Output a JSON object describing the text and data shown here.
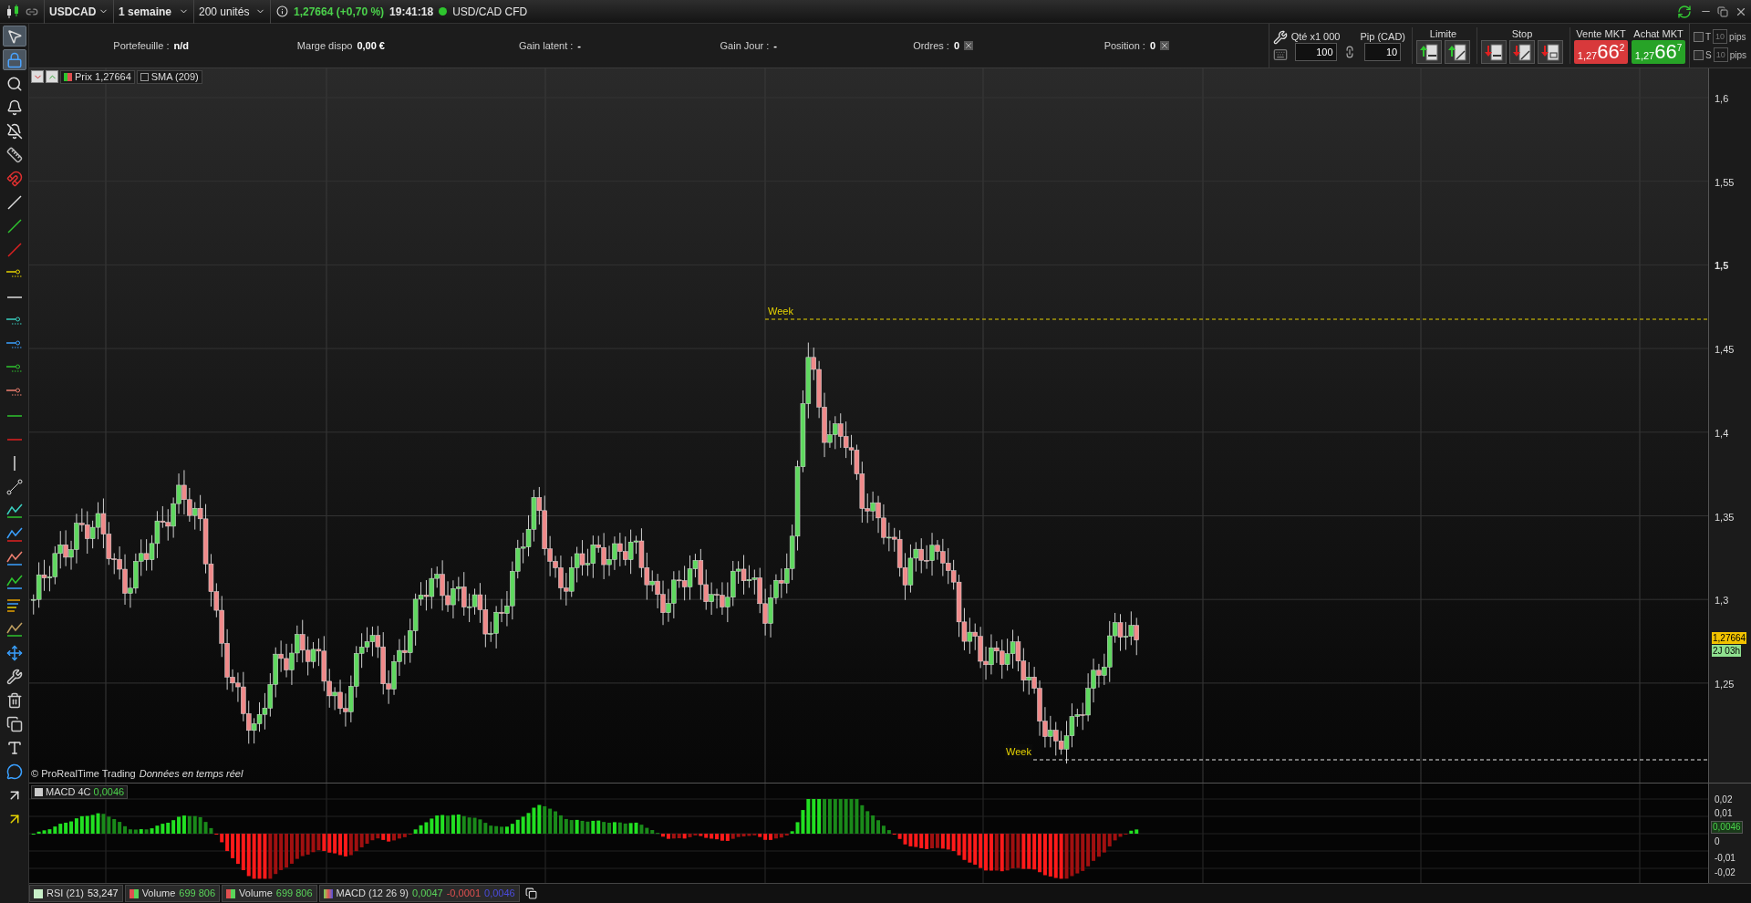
{
  "top_bar": {
    "symbol": "USDCAD",
    "period": "1 semaine",
    "quantity": "200 unités",
    "price": "1,27664",
    "change": "(+0,70 %)",
    "time": "19:41:18",
    "market_open": true,
    "instrument": "USD/CAD CFD"
  },
  "tools": [
    {
      "selected": true
    },
    {
      "selected": true
    },
    {
      "selected": false
    },
    {
      "selected": false
    },
    {
      "selected": false
    },
    {
      "selected": false
    },
    {
      "selected": false
    },
    {
      "selected": false
    },
    {
      "selected": false
    },
    {
      "selected": false
    },
    {
      "selected": false
    },
    {
      "selected": false
    },
    {
      "selected": false
    },
    {
      "selected": false
    },
    {
      "selected": false
    },
    {
      "selected": false
    },
    {
      "selected": false
    },
    {
      "selected": false
    },
    {
      "selected": false
    },
    {
      "selected": false
    },
    {
      "selected": false
    },
    {
      "selected": false
    },
    {
      "selected": false
    },
    {
      "selected": false
    },
    {
      "selected": false
    },
    {
      "selected": false
    },
    {
      "selected": false
    },
    {
      "selected": false
    },
    {
      "selected": false
    },
    {
      "selected": false
    },
    {
      "selected": false
    },
    {
      "selected": false
    },
    {
      "selected": false
    },
    {
      "selected": false
    }
  ],
  "account": [
    {
      "label": "Portefeuille :",
      "value": "n/d",
      "clearable": false
    },
    {
      "label": "Marge dispo",
      "value": "0,00 €",
      "clearable": false
    },
    {
      "label": "Gain latent :",
      "value": "-",
      "clearable": false
    },
    {
      "label": "Gain Jour :",
      "value": "-",
      "clearable": false
    },
    {
      "label": "Ordres :",
      "value": "0",
      "clearable": true
    },
    {
      "label": "Position :",
      "value": "0",
      "clearable": true
    }
  ],
  "order_panel": {
    "qty_label": "Qté x1 000",
    "qty": "100",
    "pip_label": "Pip (CAD)",
    "pip": "10",
    "limit_label": "Limite",
    "stop_label": "Stop",
    "sell": {
      "label": "Vente MKT",
      "prefix": "1,27",
      "big": "66",
      "small": "2"
    },
    "buy": {
      "label": "Achat MKT",
      "prefix": "1,27",
      "big": "66",
      "small": "7"
    },
    "targets": [
      {
        "letter": "T",
        "checked": false,
        "placeholder": "10",
        "unit": "pips"
      },
      {
        "letter": "S",
        "checked": false,
        "placeholder": "10",
        "unit": "pips"
      }
    ]
  },
  "chart": {
    "legend": [
      {
        "kind": "price",
        "label": "Prix",
        "value": "1,27664"
      },
      {
        "kind": "sma",
        "label": "SMA (209)"
      }
    ],
    "y_labels": [
      "1,6",
      "1,55",
      "1,5",
      "1,45",
      "1,4",
      "1,35",
      "1,3",
      "1,25"
    ],
    "current_price": "1,27664",
    "countdown": "2J 03h",
    "week_labels": [
      "Week",
      "Week"
    ],
    "copyright": "© ProRealTime Trading",
    "source": "Données en temps réel"
  },
  "macd_pane": {
    "name": "MACD 4C",
    "value": "0,0046",
    "y_labels": [
      "0,02",
      "0,01",
      "0",
      "-0,01",
      "-0,02"
    ],
    "current": "0,0046"
  },
  "indicator_tabs": [
    {
      "kind": "plain",
      "name": "RSI (21)",
      "values": [
        {
          "text": "53,247",
          "color": "#e8e8e8"
        }
      ]
    },
    {
      "kind": "bicolor",
      "name": "Volume",
      "values": [
        {
          "text": "699 806",
          "color": "#5ad45a"
        }
      ]
    },
    {
      "kind": "bicolor",
      "name": "Volume",
      "values": [
        {
          "text": "699 806",
          "color": "#5ad45a"
        }
      ]
    },
    {
      "kind": "tricolor",
      "name": "MACD (12 26 9)",
      "values": [
        {
          "text": "0,0047",
          "color": "#5ad45a"
        },
        {
          "text": "-0,0001",
          "color": "#e05050"
        },
        {
          "text": "0,0046",
          "color": "#4b4bdc"
        }
      ]
    }
  ]
}
